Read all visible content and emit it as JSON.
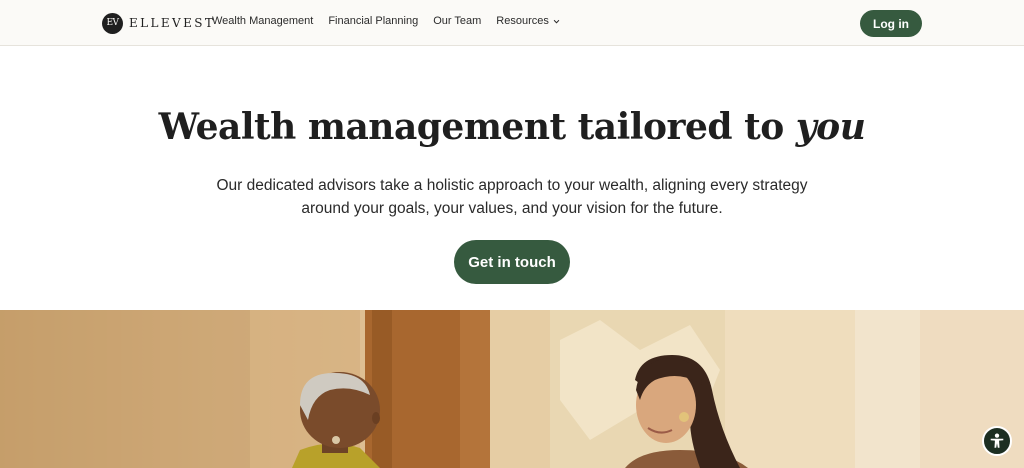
{
  "brand": {
    "mark": "EV",
    "name": "ELLEVEST"
  },
  "nav": {
    "items": [
      {
        "label": "Wealth Management"
      },
      {
        "label": "Financial Planning"
      },
      {
        "label": "Our Team"
      },
      {
        "label": "Resources"
      }
    ]
  },
  "header": {
    "login_label": "Log in"
  },
  "hero": {
    "title_main": "Wealth management tailored to",
    "title_emphasis": "you",
    "subtitle_line1": "Our dedicated advisors take a holistic approach to your wealth, aligning every strategy",
    "subtitle_line2": "around your goals, your values, and your vision for the future.",
    "cta_label": "Get in touch"
  },
  "icons": {
    "resources_dropdown": "chevron-down-icon",
    "accessibility": "accessibility-icon"
  },
  "colors": {
    "accent": "#365a3f",
    "header_bg": "#fbfaf7",
    "text": "#1f1f1f",
    "accessibility_bg": "#1c2e22"
  }
}
